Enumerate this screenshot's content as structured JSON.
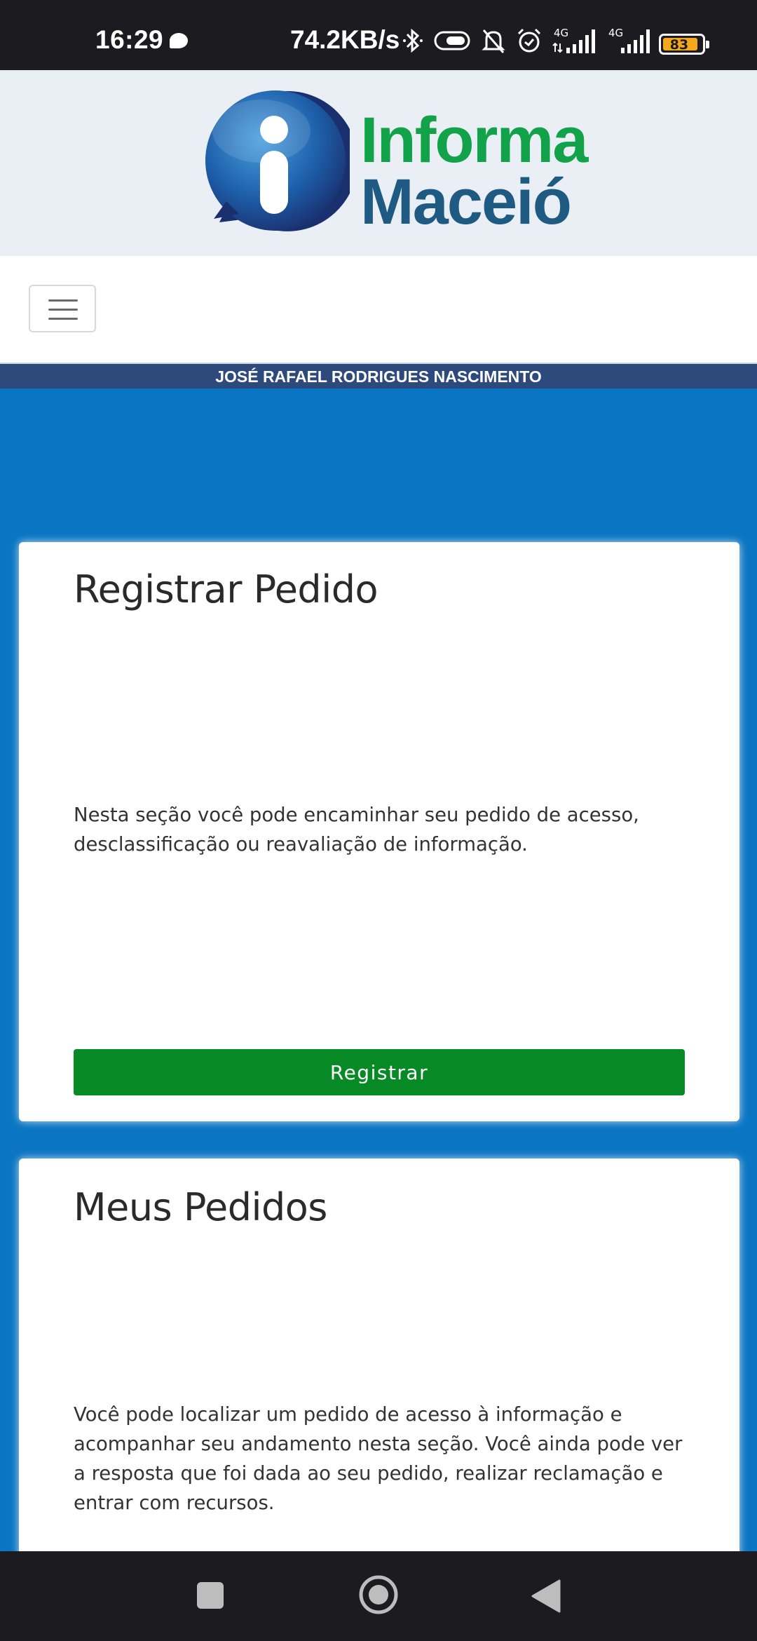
{
  "status_bar": {
    "time": "16:29",
    "network_speed": "74.2KB/s",
    "battery_level": "83",
    "icons": [
      "chat-bubble-icon",
      "bluetooth-icon",
      "vibrate-icon",
      "bell-off-icon",
      "alarm-icon",
      "signal-4g-icon",
      "signal-4g-icon",
      "battery-icon"
    ]
  },
  "header": {
    "logo_line1": "Informa",
    "logo_line2": "Maceió",
    "logo_colors": {
      "line1": "#12a34a",
      "line2": "#1e5a82",
      "mark": "#1d5ea8"
    }
  },
  "nav": {
    "menu_icon": "hamburger-menu-icon",
    "user_name": "JOSÉ RAFAEL RODRIGUES NASCIMENTO"
  },
  "cards": [
    {
      "title": "Registrar Pedido",
      "description": "Nesta seção você pode encaminhar seu pedido de acesso, desclassificação ou reavaliação de informação.",
      "button_label": "Registrar"
    },
    {
      "title": "Meus Pedidos",
      "description": "Você pode localizar um pedido de acesso à informação e acompanhar seu andamento nesta seção. Você ainda pode ver a resposta que foi dada ao seu pedido, realizar reclamação e entrar com recursos."
    }
  ],
  "colors": {
    "page_background": "#0a75c2",
    "user_bar": "#2e4a7c",
    "primary_button": "#078a26"
  },
  "system_nav": [
    "recents-square-icon",
    "home-circle-icon",
    "back-triangle-icon"
  ]
}
